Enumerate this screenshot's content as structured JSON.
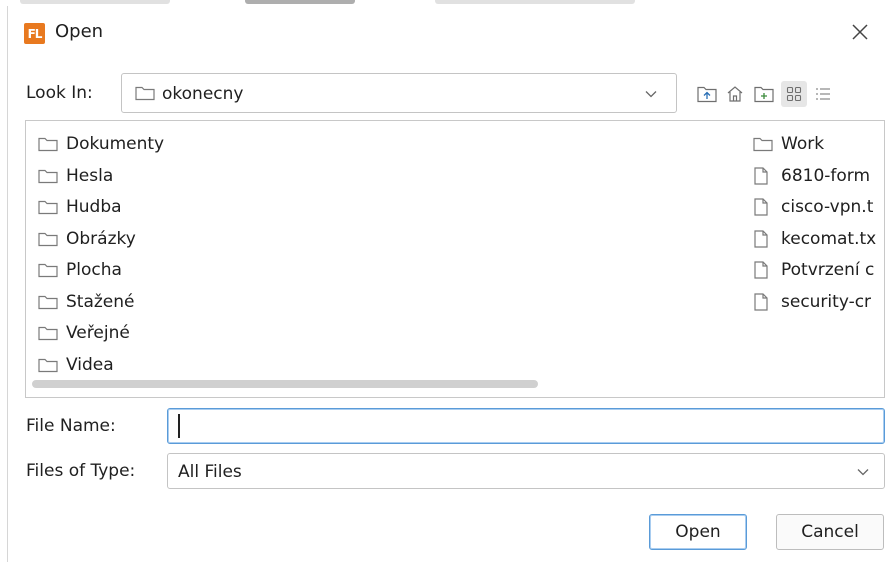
{
  "dialog": {
    "app_icon_text": "FL",
    "title": "Open",
    "close_glyph": "×"
  },
  "look_in": {
    "label": "Look In:",
    "value": "okonecny"
  },
  "toolbar": {
    "icons": [
      "up-folder-icon",
      "home-icon",
      "new-folder-icon",
      "list-view-icon",
      "details-view-icon"
    ]
  },
  "files": [
    {
      "name": "Dokumenty",
      "kind": "folder"
    },
    {
      "name": "Hesla",
      "kind": "folder"
    },
    {
      "name": "Hudba",
      "kind": "folder"
    },
    {
      "name": "Obrázky",
      "kind": "folder"
    },
    {
      "name": "Plocha",
      "kind": "folder"
    },
    {
      "name": "Stažené",
      "kind": "folder"
    },
    {
      "name": "Veřejné",
      "kind": "folder"
    },
    {
      "name": "Videa",
      "kind": "folder"
    },
    {
      "name": "Work",
      "kind": "folder"
    },
    {
      "name": "6810-form",
      "kind": "file"
    },
    {
      "name": "cisco-vpn.t",
      "kind": "file"
    },
    {
      "name": "kecomat.tx",
      "kind": "file"
    },
    {
      "name": "Potvrzení c",
      "kind": "file"
    },
    {
      "name": "security-cr",
      "kind": "file"
    }
  ],
  "file_name": {
    "label": "File Name:",
    "value": "",
    "placeholder": ""
  },
  "file_type": {
    "label": "Files of Type:",
    "value": "All Files"
  },
  "buttons": {
    "open": "Open",
    "cancel": "Cancel"
  },
  "colors": {
    "accent": "#5a9bd8",
    "app_icon": "#e8791f"
  }
}
